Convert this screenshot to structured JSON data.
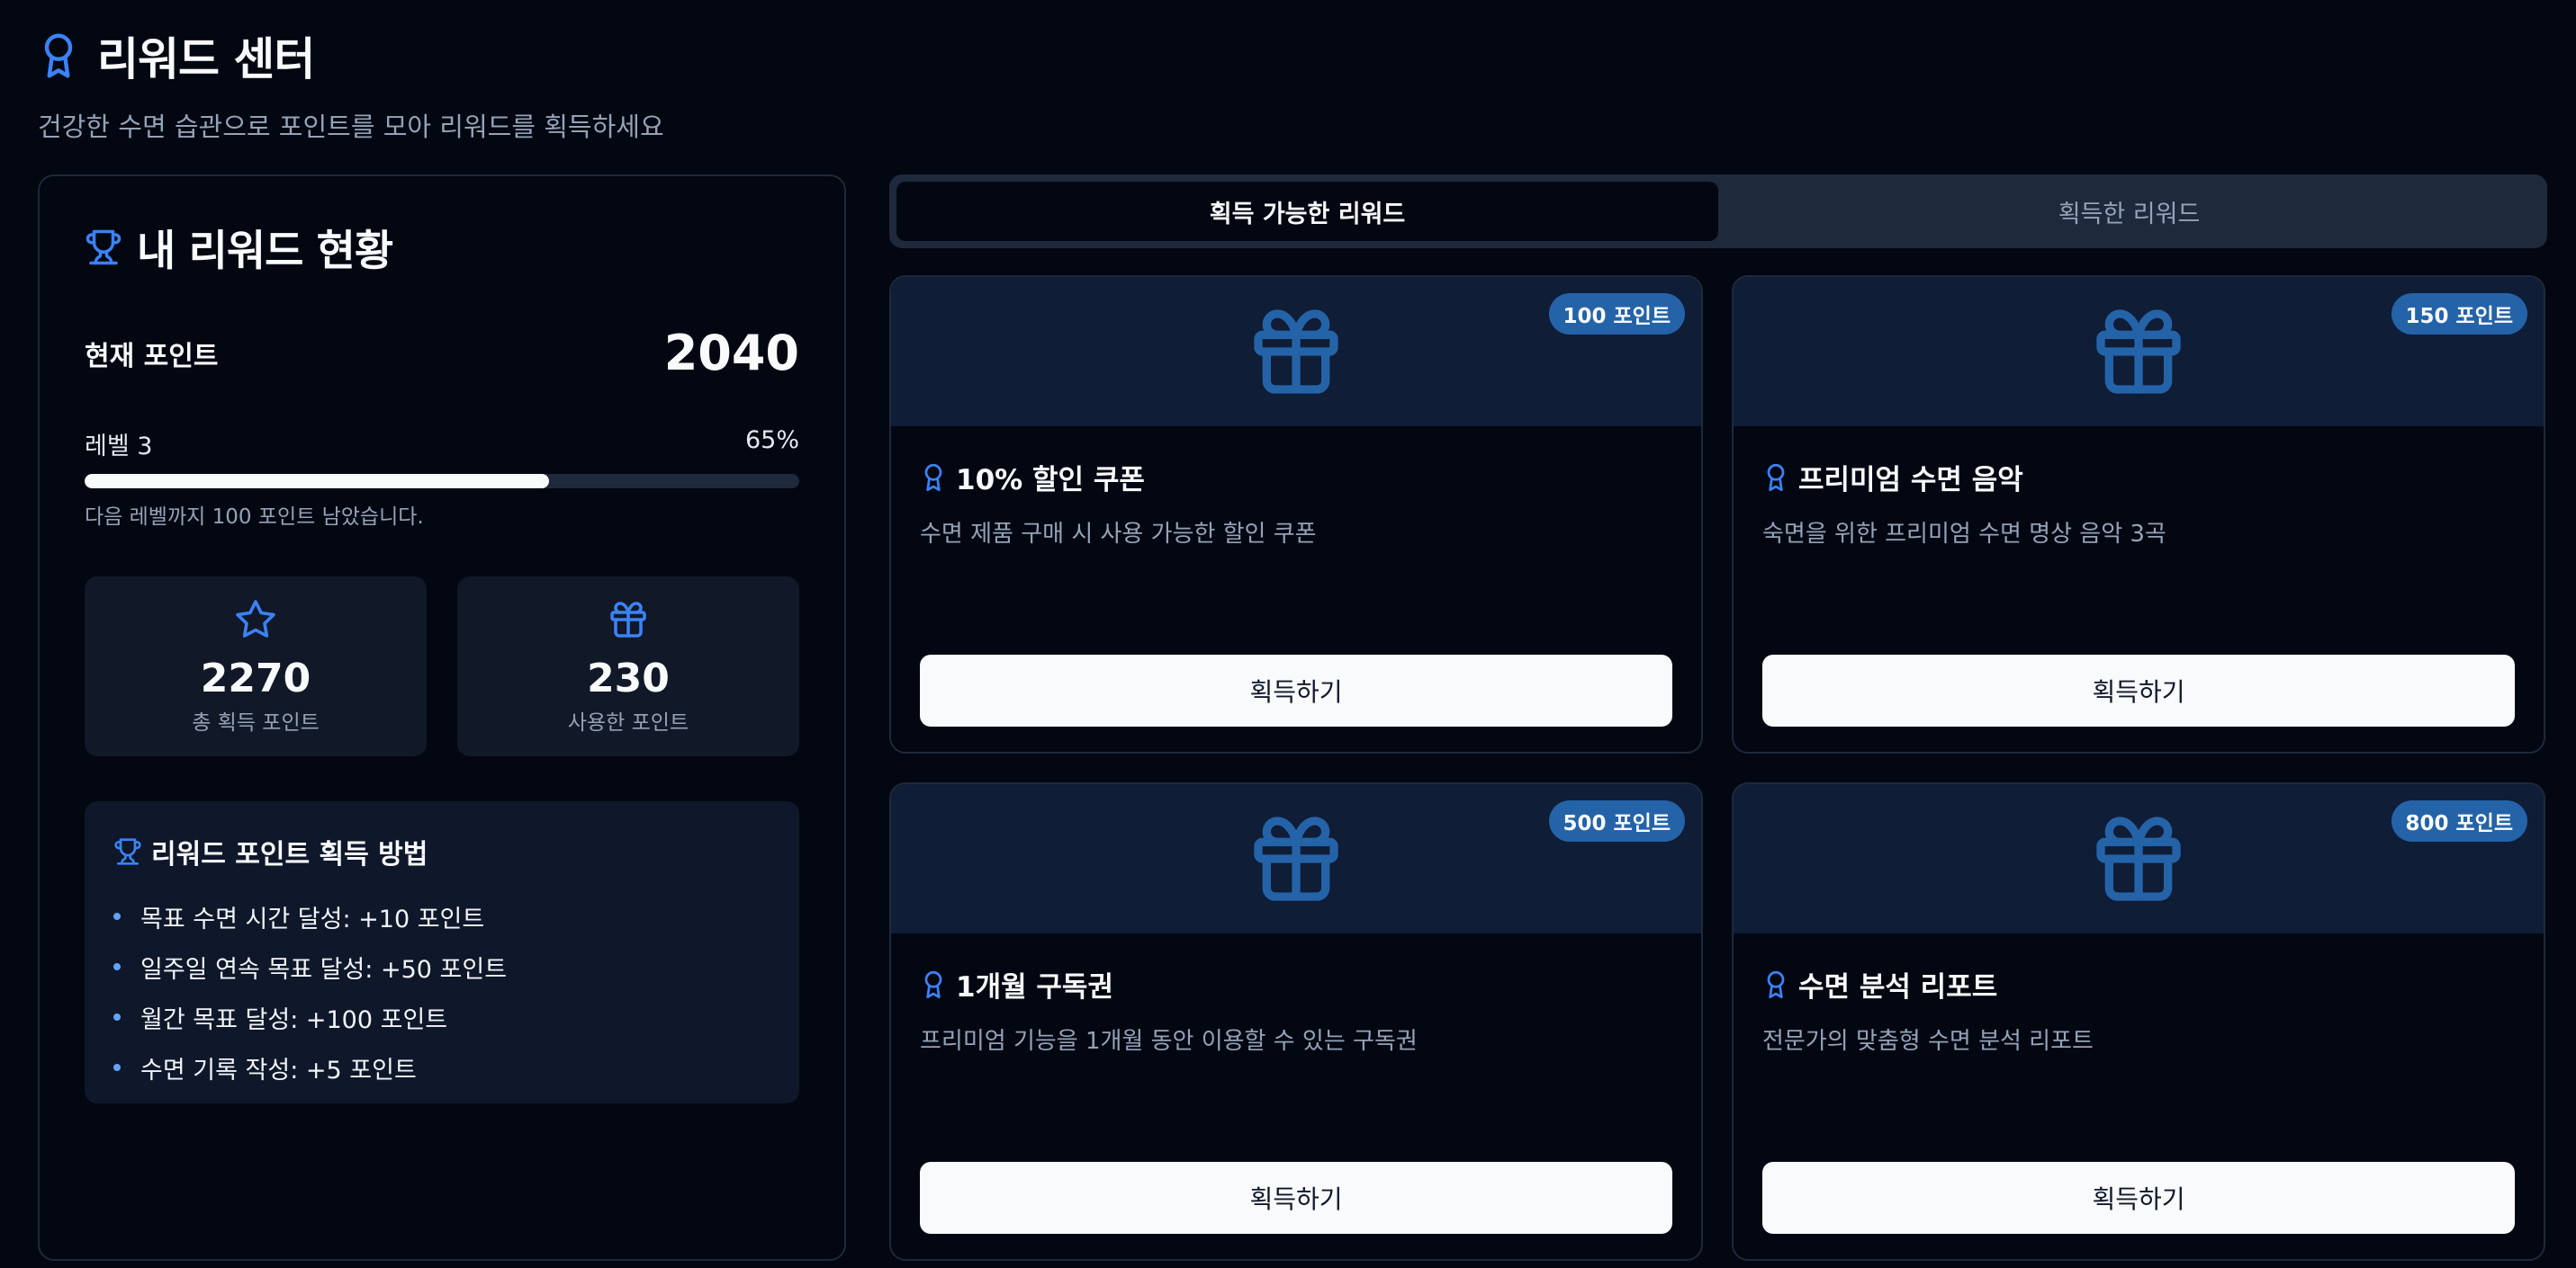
{
  "header": {
    "title": "리워드 센터",
    "subtitle": "건강한 수면 습관으로 포인트를 모아 리워드를 획득하세요"
  },
  "status": {
    "title": "내 리워드 현황",
    "current_points_label": "현재 포인트",
    "current_points": "2040",
    "level_label": "레벨 3",
    "level_percent": "65%",
    "level_progress": 0.65,
    "level_hint": "다음 레벨까지 100 포인트 남았습니다.",
    "stats": [
      {
        "icon": "star-icon",
        "value": "2270",
        "label": "총 획득 포인트"
      },
      {
        "icon": "gift-icon",
        "value": "230",
        "label": "사용한 포인트"
      }
    ],
    "howto": {
      "title": "리워드 포인트 획득 방법",
      "items": [
        "목표 수면 시간 달성: +10 포인트",
        "일주일 연속 목표 달성: +50 포인트",
        "월간 목표 달성: +100 포인트",
        "수면 기록 작성: +5 포인트"
      ]
    }
  },
  "tabs": [
    {
      "label": "획득 가능한 리워드",
      "active": true
    },
    {
      "label": "획득한 리워드",
      "active": false
    }
  ],
  "rewards": [
    {
      "cost": "100 포인트",
      "title": "10% 할인 쿠폰",
      "desc": "수면 제품 구매 시 사용 가능한 할인 쿠폰",
      "button": "획득하기"
    },
    {
      "cost": "150 포인트",
      "title": "프리미엄 수면 음악",
      "desc": "숙면을 위한 프리미엄 수면 명상 음악 3곡",
      "button": "획득하기"
    },
    {
      "cost": "500 포인트",
      "title": "1개월 구독권",
      "desc": "프리미엄 기능을 1개월 동안 이용할 수 있는 구독권",
      "button": "획득하기"
    },
    {
      "cost": "800 포인트",
      "title": "수면 분석 리포트",
      "desc": "전문가의 맞춤형 수면 분석 리포트",
      "button": "획득하기"
    }
  ],
  "colors": {
    "background": "#030712",
    "accent": "#3b82f6",
    "badge": "#2563a8",
    "banner": "#0f1d37"
  }
}
